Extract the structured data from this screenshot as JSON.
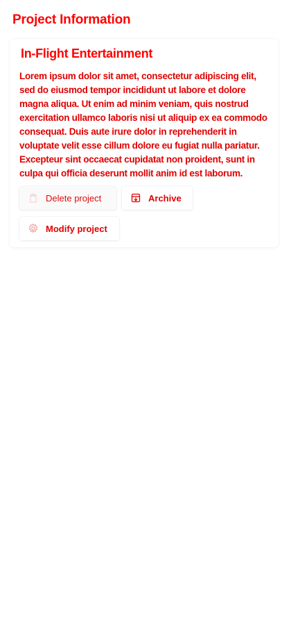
{
  "header": {
    "title": "Project Information"
  },
  "card": {
    "title": "In-Flight Entertainment",
    "description": "Lorem ipsum dolor sit amet, consectetur adipiscing elit, sed do eiusmod tempor incididunt ut labore et dolore magna aliqua. Ut enim ad minim veniam, quis nostrud exercitation ullamco laboris nisi ut aliquip ex ea commodo consequat. Duis aute irure dolor in reprehenderit in voluptate velit esse cillum dolore eu fugiat nulla pariatur. Excepteur sint occaecat cupidatat non proident, sunt in culpa qui officia deserunt mollit anim id est laborum."
  },
  "actions": {
    "delete_label": "Delete project",
    "archive_label": "Archive",
    "modify_label": "Modify project"
  },
  "icons": {
    "delete": "trash-icon",
    "archive": "archive-box-icon",
    "modify": "gear-icon"
  },
  "colors": {
    "text": "#e00000",
    "accent": "#ff0000"
  }
}
